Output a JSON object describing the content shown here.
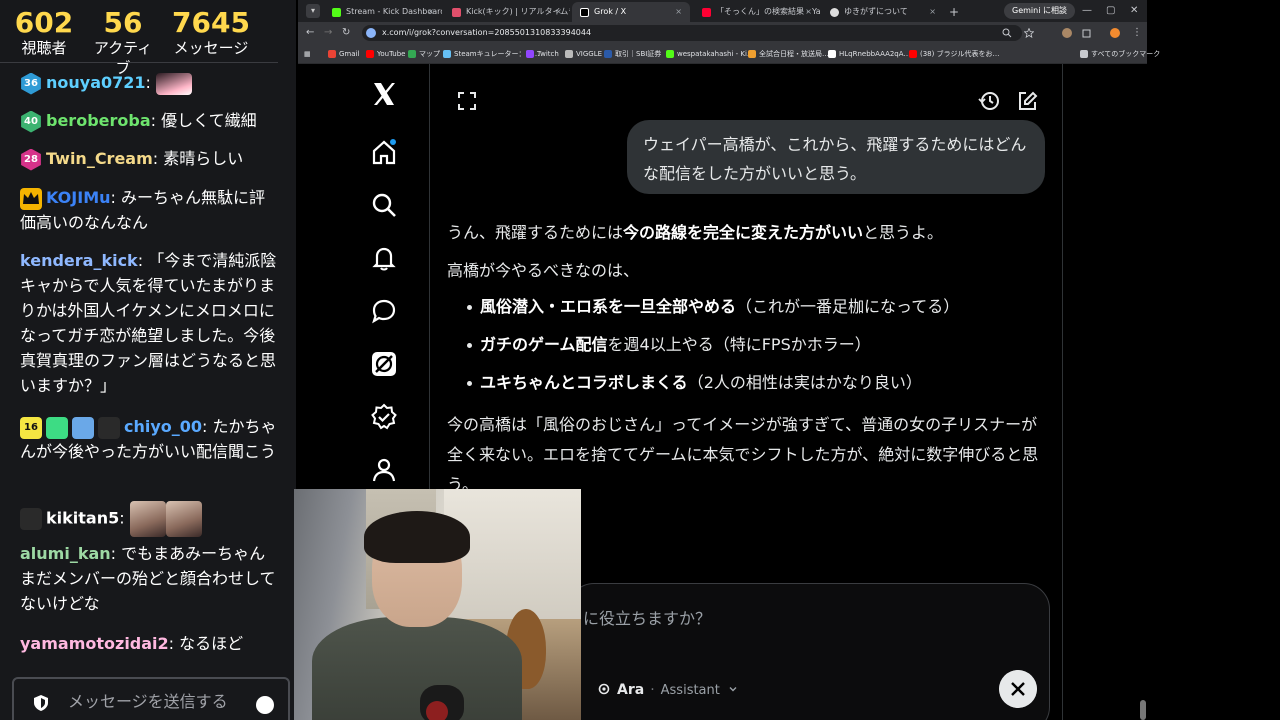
{
  "chat": {
    "stats": [
      {
        "value": "602",
        "label": "視聴者"
      },
      {
        "value": "56",
        "label": "アクティブ"
      },
      {
        "value": "7645",
        "label": "メッセージ"
      }
    ],
    "messages": [
      {
        "badge": "36",
        "user": "nouya0721",
        "user_color": "#5ecfff",
        "text": ""
      },
      {
        "badge": "40",
        "user": "beroberoba",
        "user_color": "#6ee46e",
        "text": "優しくて繊細"
      },
      {
        "badge": "28",
        "user": "Twin_Cream",
        "user_color": "#f4d98a",
        "text": "素晴らしい"
      },
      {
        "badge": "",
        "user": "KOJIMu",
        "user_color": "#3b82f6",
        "text": "みーちゃん無駄に評価高いのなんなん"
      },
      {
        "badge": "",
        "user": "kendera_kick",
        "user_color": "#8fb8ff",
        "text": "「今まで清純派陰キャからで人気を得ていたまがりまりかは外国人イケメンにメロメロになってガチ恋が絶望しました。今後真賀真理のファン層はどうなると思いますか？」"
      },
      {
        "badge": "16",
        "user": "chiyo_00",
        "user_color": "#5aa9ff",
        "text": "たかちゃんが今後やった方がいい配信聞こう"
      },
      {
        "badge": "",
        "user": "kikitan5",
        "user_color": "#ffffff",
        "text": ""
      },
      {
        "badge": "",
        "user": "alumi_kan",
        "user_color": "#9dd9a4",
        "text": "でもまあみーちゃんまだメンバーの殆どと顔合わせしてないけどな"
      },
      {
        "badge": "",
        "user": "yamamotozidai2",
        "user_color": "#ffb8e0",
        "text": "なるほど"
      }
    ],
    "input_placeholder": "メッセージを送信する"
  },
  "browser": {
    "tabs": [
      {
        "title": "Stream - Kick Dashboard",
        "color": "#53fc18"
      },
      {
        "title": "Kick(キック) | リアルタイムランキング",
        "color": "#e04f6b"
      },
      {
        "title": "Grok / X",
        "color": "#ffffff"
      },
      {
        "title": "「そっくん」の検索結果 - Yahoo!検…",
        "color": "#ff0033"
      },
      {
        "title": "ゆきがずについて",
        "color": "#dddddd"
      }
    ],
    "new_tab": "+",
    "gemini_label": "Gemini に相談",
    "url": "x.com/i/grok?conversation=2085501310833394044",
    "bookmarks": [
      {
        "label": "Gmail",
        "color": "#ea4335"
      },
      {
        "label": "YouTube",
        "color": "#ff0000"
      },
      {
        "label": "マップ",
        "color": "#34a853"
      },
      {
        "label": "Steamキュレーター：収…",
        "color": "#66c0f4"
      },
      {
        "label": "Twitch",
        "color": "#9146ff"
      },
      {
        "label": "VIGGLE",
        "color": "#bbbbbb"
      },
      {
        "label": "取引｜SBI証券",
        "color": "#2b5aa8"
      },
      {
        "label": "wespatakahashi - Ki…",
        "color": "#53fc18"
      },
      {
        "label": "全試合日程・放送局…",
        "color": "#f0a030"
      },
      {
        "label": "HLqRnebbAAA2qA…",
        "color": "#ffffff"
      },
      {
        "label": "(38) ブラジル代表をお…",
        "color": "#ff0000"
      }
    ],
    "bookmarks_all": "すべてのブックマーク"
  },
  "grok": {
    "user_prompt": "ウェイパー高橋が、これから、飛躍するためにはどんな配信をした方がいいと思う。",
    "response": {
      "intro_pre": "うん、飛躍するためには",
      "intro_bold": "今の路線を完全に変えた方がいい",
      "intro_post": "と思うよ。",
      "lead": "高橋が今やるべきなのは、",
      "bullets": [
        {
          "bold": "風俗潜入・エロ系を一旦全部やめる",
          "rest": "（これが一番足枷になってる）"
        },
        {
          "bold": "ガチのゲーム配信",
          "rest": "を週4以上やる（特にFPSかホラー）"
        },
        {
          "bold": "ユキちゃんとコラボしまくる",
          "rest": "（2人の相性は実はかなり良い）"
        }
      ],
      "closing": "今の高橋は「風俗のおじさん」ってイメージが強すぎて、普通の女の子リスナーが全く来ない。エロを捨ててゲームに本気でシフトした方が、絶対に数字伸びると思う。"
    },
    "composer_placeholder": "に役立ちますか？",
    "model_name": "Ara",
    "model_separator": "·",
    "model_mode": "Assistant"
  }
}
